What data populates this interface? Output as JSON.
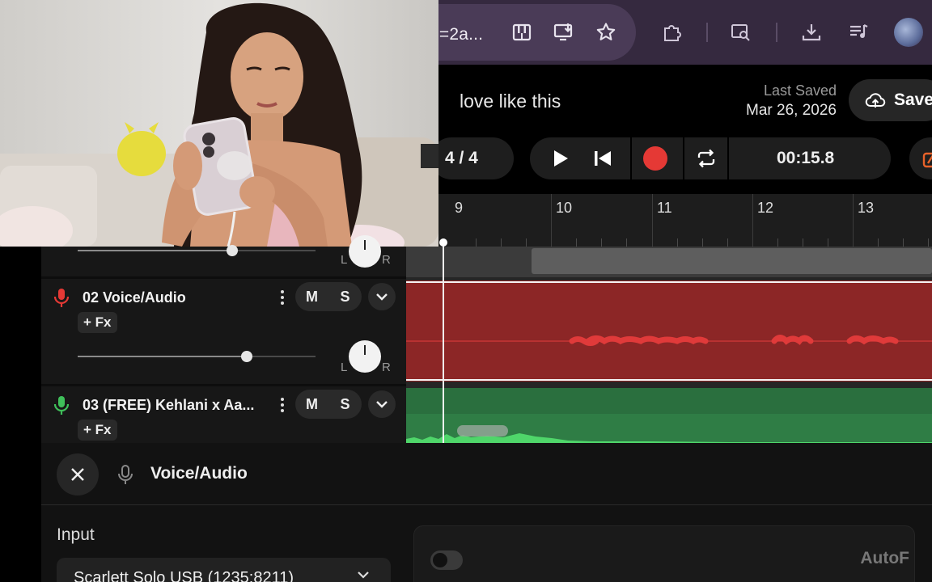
{
  "browser": {
    "url_fragment": "l=2a...",
    "icons": [
      "piano-icon",
      "install-app-icon",
      "bookmark-star-icon",
      "extensions-icon",
      "search-tab-icon",
      "downloads-icon",
      "media-queue-icon",
      "profile-avatar"
    ]
  },
  "project": {
    "name": "love like this",
    "last_saved_label": "Last Saved",
    "last_saved_date": "Mar 26, 2026",
    "save_label": "Save"
  },
  "transport": {
    "bar_counter": "4 / 4",
    "timecode": "00:15.8",
    "record_color": "#e53935"
  },
  "ruler": {
    "bars": [
      "9",
      "10",
      "11",
      "12",
      "13"
    ]
  },
  "tracks": [
    {
      "number": "02",
      "label": "02  Voice/Audio",
      "fx_label": "+ Fx",
      "mute_label": "M",
      "solo_label": "S",
      "volume": 0.71,
      "pan_left": "L",
      "pan_right": "R",
      "icon": "microphone-icon",
      "icon_color": "#e53935",
      "lane_color": "#8c2626"
    },
    {
      "number": "03",
      "label": "03  (FREE) Kehlani x Aa...",
      "fx_label": "+ Fx",
      "mute_label": "M",
      "solo_label": "S",
      "icon": "microphone-icon",
      "icon_color": "#3fbf5a",
      "lane_color": "#2f7d45"
    }
  ],
  "track_above_pan": {
    "left": "L",
    "right": "R"
  },
  "panel": {
    "title": "Voice/Audio",
    "input_label": "Input",
    "input_device": "Scarlett Solo USB (1235:8211)",
    "auto_label": "AutoF"
  }
}
